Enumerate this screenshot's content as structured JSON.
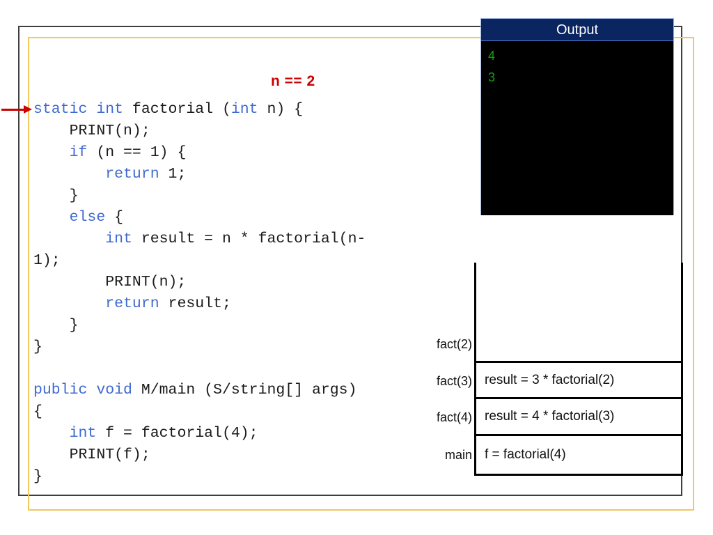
{
  "annotation": {
    "text": "n == 2",
    "color": "#cc0000"
  },
  "code": {
    "language": "java-like",
    "keyword_color": "#3f6ad0",
    "text_color": "#1a1a1a",
    "lines": [
      [
        {
          "t": "static int",
          "k": true
        },
        {
          "t": " factorial (",
          "k": false
        },
        {
          "t": "int",
          "k": true
        },
        {
          "t": " n) {",
          "k": false
        }
      ],
      [
        {
          "t": "    PRINT(n);",
          "k": false
        }
      ],
      [
        {
          "t": "    ",
          "k": false
        },
        {
          "t": "if",
          "k": true
        },
        {
          "t": " (n == 1) {",
          "k": false
        }
      ],
      [
        {
          "t": "        ",
          "k": false
        },
        {
          "t": "return",
          "k": true
        },
        {
          "t": " 1;",
          "k": false
        }
      ],
      [
        {
          "t": "    }",
          "k": false
        }
      ],
      [
        {
          "t": "    ",
          "k": false
        },
        {
          "t": "else",
          "k": true
        },
        {
          "t": " {",
          "k": false
        }
      ],
      [
        {
          "t": "        ",
          "k": false
        },
        {
          "t": "int",
          "k": true
        },
        {
          "t": " result = n * factorial(n-",
          "k": false
        }
      ],
      [
        {
          "t": "1);",
          "k": false
        }
      ],
      [
        {
          "t": "        PRINT(n);",
          "k": false
        }
      ],
      [
        {
          "t": "        ",
          "k": false
        },
        {
          "t": "return",
          "k": true
        },
        {
          "t": " result;",
          "k": false
        }
      ],
      [
        {
          "t": "    }",
          "k": false
        }
      ],
      [
        {
          "t": "}",
          "k": false
        }
      ],
      [
        {
          "t": "",
          "k": false
        }
      ],
      [
        {
          "t": "public void",
          "k": true
        },
        {
          "t": " M/main (S/string[] args)",
          "k": false
        }
      ],
      [
        {
          "t": "{",
          "k": false
        }
      ],
      [
        {
          "t": "    ",
          "k": false
        },
        {
          "t": "int",
          "k": true
        },
        {
          "t": " f = factorial(4);",
          "k": false
        }
      ],
      [
        {
          "t": "    PRINT(f);",
          "k": false
        }
      ],
      [
        {
          "t": "}",
          "k": false
        }
      ]
    ]
  },
  "console": {
    "title": "Output",
    "title_bg": "#0a2560",
    "body_bg": "#000000",
    "text_color": "#11a011",
    "lines": [
      "4",
      "3"
    ]
  },
  "call_stack": {
    "frames": [
      {
        "label": "fact(2)",
        "expression": ""
      },
      {
        "label": "fact(3)",
        "expression": "result = 3 * factorial(2)"
      },
      {
        "label": "fact(4)",
        "expression": "result = 4 * factorial(3)"
      },
      {
        "label": "main",
        "expression": "f = factorial(4)"
      }
    ]
  },
  "frames_decor": {
    "outer_color": "#3f3f3f",
    "inner_color": "#f2c75c"
  }
}
